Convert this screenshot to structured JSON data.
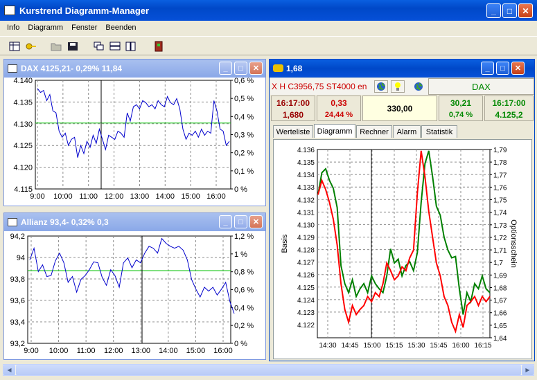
{
  "app": {
    "title": "Kurstrend Diagramm-Manager"
  },
  "menu": [
    "Info",
    "Diagramm",
    "Fenster",
    "Beenden"
  ],
  "toolbar_icons": [
    "table-icon",
    "key-icon",
    "open-folder-icon",
    "save-disk-icon",
    "cascade-windows-icon",
    "tile-horizontal-icon",
    "tile-vertical-icon",
    "exit-door-icon"
  ],
  "dax": {
    "title": "DAX  4125,21-  0,29% 11,84"
  },
  "allianz": {
    "title": "Allianz  93,4-  0,32% 0,3"
  },
  "option": {
    "title": "1,68",
    "header": {
      "ticker": "X H C3956,75 ST4000 en",
      "dax_label": "DAX"
    },
    "quote": {
      "time_left": "16:17:00",
      "price_left": "1,680",
      "change": "0,33",
      "change_pct": "24,44 %",
      "strike": "330,00",
      "change_right": "30,21",
      "change_pct_right": "0,74 %",
      "time_right": "16:17:00",
      "price_right": "4.125,2"
    },
    "tabs": [
      "Werteliste",
      "Diagramm",
      "Rechner",
      "Alarm",
      "Statistik"
    ],
    "left_axis_label": "Basis",
    "right_axis_label": "Optionsschein"
  },
  "colors": {
    "series_blue": "#0000cc",
    "series_green": "#008000",
    "series_red": "#ff0000",
    "ref_line": "#00c000"
  },
  "chart_data": [
    {
      "type": "line",
      "series": [
        {
          "values": [
            4.1385,
            4.1375,
            4.138,
            4.1355,
            4.137,
            4.133,
            4.1325,
            4.128,
            4.1265,
            4.1275,
            4.1245,
            4.126,
            4.1265,
            4.1215,
            4.1245,
            4.1225,
            4.1255,
            4.124,
            4.127,
            4.125,
            4.1285,
            4.126,
            4.1235,
            4.127,
            4.1265,
            4.126,
            4.128,
            4.1275,
            4.1265,
            4.1325,
            4.1305,
            4.134,
            4.1345,
            4.1335,
            4.1355,
            4.135,
            4.134,
            4.1345,
            4.1335,
            4.1355,
            4.1345,
            4.134,
            4.1365,
            4.135,
            4.1345,
            4.136,
            4.1335,
            4.1285,
            4.126,
            4.1275,
            4.127,
            4.128,
            4.1265,
            4.1285,
            4.127,
            4.128,
            4.1275,
            4.1355,
            4.133,
            4.1285,
            4.128,
            4.1245,
            4.1255
          ]
        }
      ],
      "x_ticks": [
        "9:00",
        "10:00",
        "11:00",
        "12:00",
        "13:00",
        "14:00",
        "15:00",
        "16:00"
      ],
      "y_ticks": [
        "4.140",
        "4.135",
        "4.130",
        "4.125",
        "4.120",
        "4.115"
      ],
      "y2_ticks": [
        "0,6 %",
        "0,5 %",
        "0,4 %",
        "0,3 %",
        "0,2 %",
        "0,1 %",
        "0 %"
      ],
      "ylim": [
        4.1138,
        4.1405
      ],
      "reference": 4.13,
      "grid": true
    },
    {
      "type": "line",
      "series": [
        {
          "values": [
            93.98,
            94.1,
            93.86,
            93.93,
            93.81,
            93.82,
            93.97,
            94.05,
            93.95,
            93.75,
            93.81,
            93.65,
            93.78,
            93.82,
            93.88,
            93.96,
            93.95,
            93.8,
            93.72,
            93.88,
            93.82,
            93.7,
            93.95,
            94.0,
            93.9,
            93.98,
            93.95,
            94.05,
            94.12,
            94.1,
            94.05,
            94.2,
            94.15,
            94.12,
            94.1,
            94.12,
            94.08,
            93.98,
            93.78,
            93.68,
            93.6,
            93.7,
            93.66,
            93.7,
            93.62,
            93.68,
            93.75,
            93.55,
            93.43
          ]
        }
      ],
      "x_ticks": [
        "9:00",
        "10:00",
        "11:00",
        "12:00",
        "13:00",
        "14:00",
        "15:00",
        "16:00"
      ],
      "y_ticks": [
        "94,2",
        "94",
        "93,8",
        "93,6",
        "93,4",
        "93,2"
      ],
      "y2_ticks": [
        "1,2 %",
        "1 %",
        "0,8 %",
        "0,6 %",
        "0,4 %",
        "0,2 %",
        "0 %"
      ],
      "ylim": [
        93.125,
        94.225
      ],
      "reference": 93.87,
      "grid": true
    },
    {
      "type": "line",
      "series": [
        {
          "color": "#008000",
          "values": [
            4.1331,
            4.1348,
            4.1351,
            4.1342,
            4.1336,
            4.1321,
            4.1276,
            4.1262,
            4.1255,
            4.1265,
            4.1252,
            4.1258,
            4.1262,
            4.1255,
            4.1268,
            4.1262,
            4.1258,
            4.1255,
            4.1268,
            4.1289,
            4.1278,
            4.1281,
            4.1268,
            4.1276,
            4.1279,
            4.1272,
            4.1286,
            4.1325,
            4.1355,
            4.1365,
            4.1345,
            4.1322,
            4.1315,
            4.1298,
            4.1288,
            4.1282,
            4.1283,
            4.1258,
            4.1238,
            4.1255,
            4.1248,
            4.1262,
            4.1258,
            4.1268,
            4.1258,
            4.1255
          ]
        },
        {
          "color": "#ff0000",
          "values": [
            4.1331,
            4.1342,
            4.1335,
            4.1325,
            4.1312,
            4.1292,
            4.1262,
            4.1242,
            4.1232,
            4.1245,
            4.1238,
            4.1242,
            4.1245,
            4.1252,
            4.1248,
            4.1255,
            4.1252,
            4.1262,
            4.1278,
            4.1272,
            4.1265,
            4.1268,
            4.1275,
            4.1272,
            4.1282,
            4.1288,
            4.1332,
            4.1365,
            4.1345,
            4.1318,
            4.1298,
            4.1278,
            4.1268,
            4.1252,
            4.1245,
            4.1232,
            4.1225,
            4.1238,
            4.1228,
            4.1245,
            4.1248,
            4.1252,
            4.1245,
            4.1252,
            4.1248,
            4.1252
          ]
        }
      ],
      "x_ticks": [
        "14:30",
        "14:45",
        "15:00",
        "15:15",
        "15:30",
        "15:45",
        "16:00",
        "16:15"
      ],
      "y_ticks": [
        "4.136",
        "4.135",
        "4.134",
        "4.133",
        "4.132",
        "4.131",
        "4.130",
        "4.129",
        "4.128",
        "4.127",
        "4.126",
        "4.125",
        "4.124",
        "4.123",
        "4.122"
      ],
      "y2_ticks": [
        "1,79",
        "1,78",
        "1,77",
        "1,76",
        "1,75",
        "1,74",
        "1,73",
        "1,72",
        "1,71",
        "1,7",
        "1,69",
        "1,68",
        "1,67",
        "1,66",
        "1,65",
        "1,64"
      ],
      "ylim": [
        4.122,
        4.1366
      ],
      "ylabel": "Basis",
      "y2label": "Optionsschein",
      "grid": true
    }
  ]
}
